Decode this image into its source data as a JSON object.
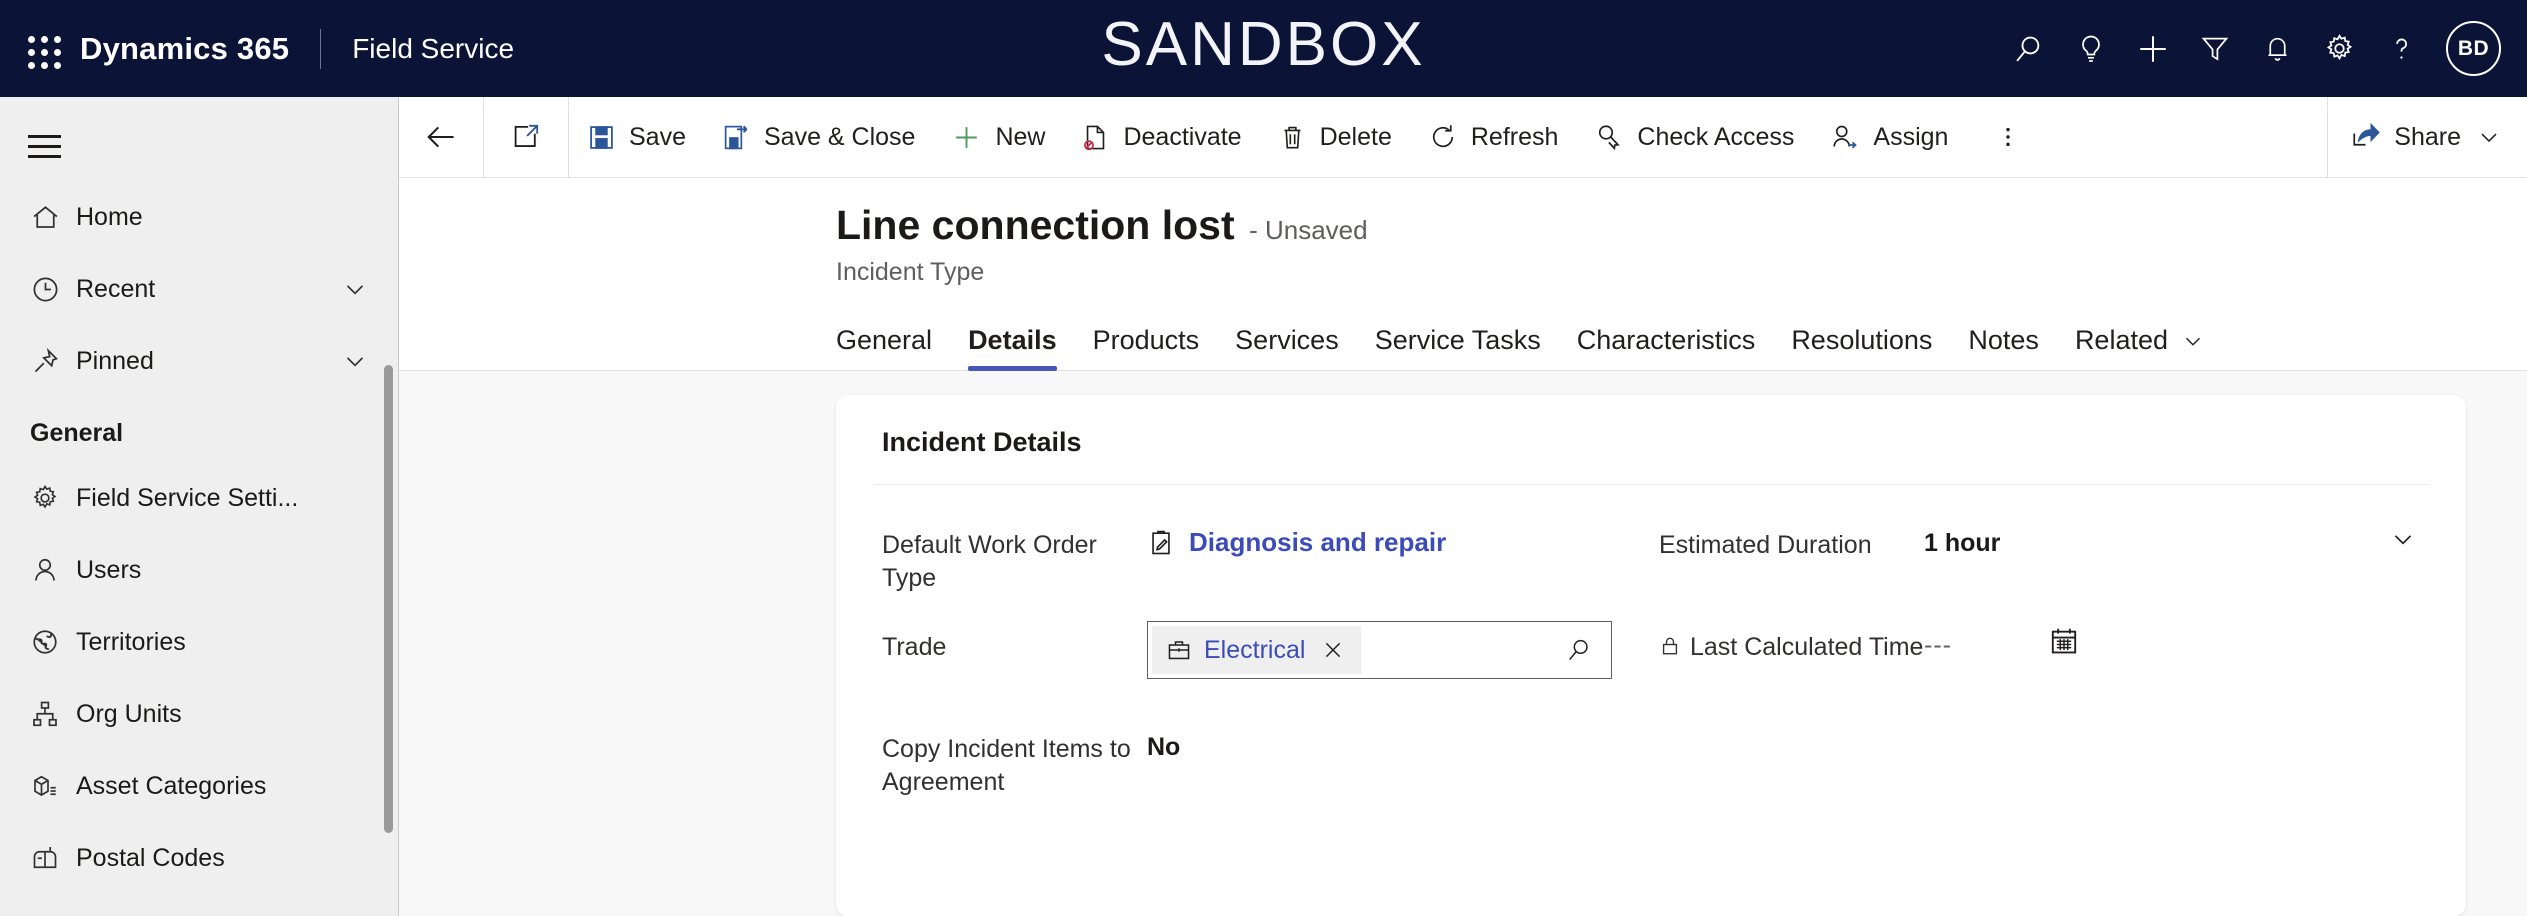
{
  "header": {
    "waffle_label": "app-launcher",
    "brand": "Dynamics 365",
    "app_name": "Field Service",
    "environment_banner": "SANDBOX",
    "icons": [
      {
        "name": "search-icon",
        "label": "Search"
      },
      {
        "name": "lightbulb-icon",
        "label": "Insights"
      },
      {
        "name": "plus-icon",
        "label": "Quick create"
      },
      {
        "name": "filter-icon",
        "label": "Filter"
      },
      {
        "name": "bell-icon",
        "label": "Notifications"
      },
      {
        "name": "gear-icon",
        "label": "Settings"
      },
      {
        "name": "question-icon",
        "label": "Help"
      }
    ],
    "avatar_initials": "BD",
    "colors": {
      "bar_background": "#0b1437",
      "text": "#ffffff"
    }
  },
  "sidebar": {
    "menu_toggle": "Expand/Collapse",
    "items": [
      {
        "label": "Home",
        "icon": "home-icon",
        "chevron": false
      },
      {
        "label": "Recent",
        "icon": "clock-icon",
        "chevron": true
      },
      {
        "label": "Pinned",
        "icon": "pin-icon",
        "chevron": true
      }
    ],
    "group_label": "General",
    "group_items": [
      {
        "label": "Field Service Setti...",
        "icon": "gear-icon"
      },
      {
        "label": "Users",
        "icon": "person-icon"
      },
      {
        "label": "Territories",
        "icon": "globe-icon"
      },
      {
        "label": "Org Units",
        "icon": "org-chart-icon"
      },
      {
        "label": "Asset Categories",
        "icon": "asset-box-icon"
      },
      {
        "label": "Postal Codes",
        "icon": "mailbox-icon"
      }
    ]
  },
  "commandbar": {
    "back_label": "Back",
    "popout_label": "Open in new window",
    "buttons": [
      {
        "label": "Save",
        "icon": "save-icon"
      },
      {
        "label": "Save & Close",
        "icon": "save-close-icon"
      },
      {
        "label": "New",
        "icon": "plus-icon"
      },
      {
        "label": "Deactivate",
        "icon": "deactivate-icon"
      },
      {
        "label": "Delete",
        "icon": "trash-icon"
      },
      {
        "label": "Refresh",
        "icon": "refresh-icon"
      },
      {
        "label": "Check Access",
        "icon": "check-access-icon"
      },
      {
        "label": "Assign",
        "icon": "assign-icon"
      }
    ],
    "overflow_label": "More commands",
    "share_label": "Share"
  },
  "record": {
    "title": "Line connection lost",
    "status": "- Unsaved",
    "entity": "Incident Type"
  },
  "tabs": [
    {
      "label": "General",
      "active": false
    },
    {
      "label": "Details",
      "active": true
    },
    {
      "label": "Products",
      "active": false
    },
    {
      "label": "Services",
      "active": false
    },
    {
      "label": "Service Tasks",
      "active": false
    },
    {
      "label": "Characteristics",
      "active": false
    },
    {
      "label": "Resolutions",
      "active": false
    },
    {
      "label": "Notes",
      "active": false
    },
    {
      "label": "Related",
      "active": false,
      "chevron": true
    }
  ],
  "form": {
    "section_title": "Incident Details",
    "left": {
      "work_order_type": {
        "label": "Default Work Order Type",
        "value": "Diagnosis and repair",
        "icon": "work-order-icon"
      },
      "trade": {
        "label": "Trade",
        "chip_value": "Electrical",
        "chip_icon": "briefcase-icon",
        "remove_label": "Remove",
        "search_label": "Lookup"
      },
      "copy_items": {
        "label": "Copy Incident Items to Agreement",
        "value": "No"
      }
    },
    "right": {
      "estimated_duration": {
        "label": "Estimated Duration",
        "value": "1 hour",
        "chevron_label": "Open dropdown"
      },
      "last_calculated_time": {
        "label": "Last Calculated Time",
        "value": "---",
        "locked": true,
        "calendar_label": "Select date"
      }
    }
  },
  "colors": {
    "accent_blue": "#4557b8",
    "link_blue": "#3b4cb8",
    "header_navy": "#0b1437",
    "sidebar_gray": "#efefef",
    "page_gray": "#f8f8f8"
  }
}
